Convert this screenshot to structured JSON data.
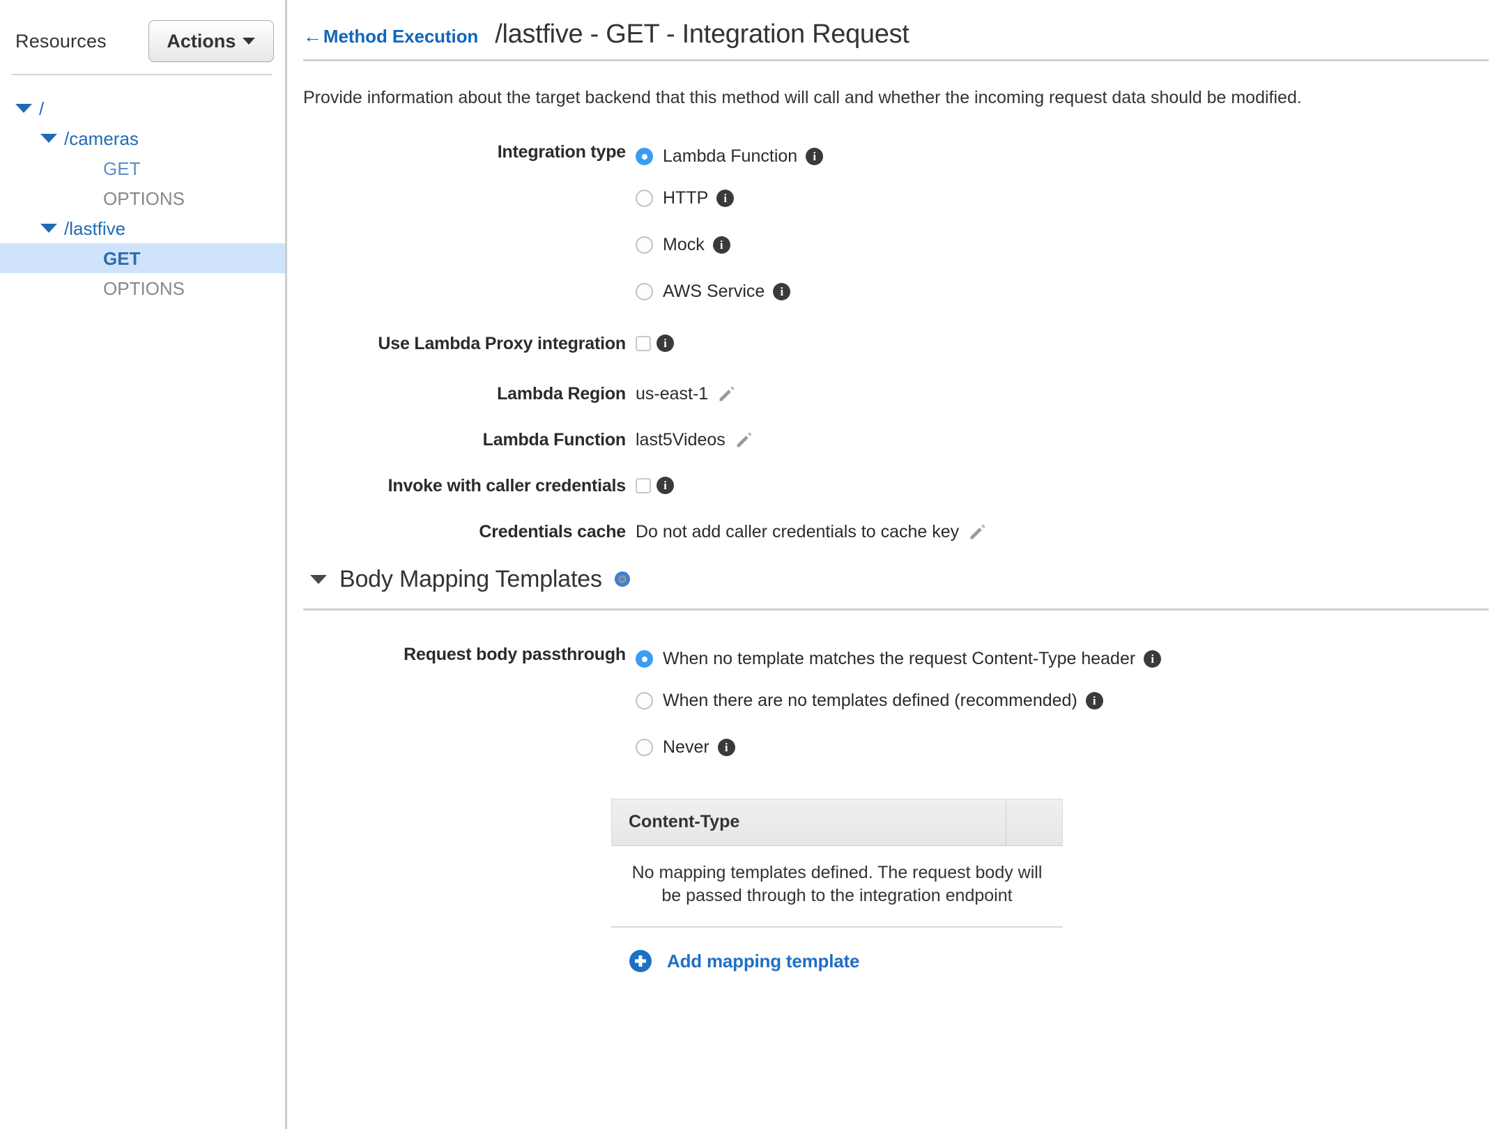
{
  "sidebar": {
    "title": "Resources",
    "actions_button": "Actions",
    "tree": [
      {
        "label": "/",
        "type": "resource",
        "indent": 0,
        "expandable": true,
        "selected": false
      },
      {
        "label": "/cameras",
        "type": "resource",
        "indent": 1,
        "expandable": true,
        "selected": false
      },
      {
        "label": "GET",
        "type": "method-get",
        "indent": 2,
        "expandable": false,
        "selected": false
      },
      {
        "label": "OPTIONS",
        "type": "method-options",
        "indent": 2,
        "expandable": false,
        "selected": false
      },
      {
        "label": "/lastfive",
        "type": "resource",
        "indent": 1,
        "expandable": true,
        "selected": false
      },
      {
        "label": "GET",
        "type": "method-get-selected",
        "indent": 2,
        "expandable": false,
        "selected": true
      },
      {
        "label": "OPTIONS",
        "type": "method-options",
        "indent": 2,
        "expandable": false,
        "selected": false
      }
    ]
  },
  "header": {
    "back_link": "Method Execution",
    "back_arrow": "←",
    "title": "/lastfive - GET - Integration Request"
  },
  "intro": "Provide information about the target backend that this method will call and whether the incoming request data should be modified.",
  "form": {
    "integration_type": {
      "label": "Integration type",
      "options": [
        {
          "label": "Lambda Function",
          "selected": true,
          "has_info": true
        },
        {
          "label": "HTTP",
          "selected": false,
          "has_info": true
        },
        {
          "label": "Mock",
          "selected": false,
          "has_info": true
        },
        {
          "label": "AWS Service",
          "selected": false,
          "has_info": true
        }
      ]
    },
    "lambda_proxy": {
      "label": "Use Lambda Proxy integration",
      "checked": false,
      "has_info": true
    },
    "lambda_region": {
      "label": "Lambda Region",
      "value": "us-east-1",
      "editable": true
    },
    "lambda_function": {
      "label": "Lambda Function",
      "value": "last5Videos",
      "editable": true
    },
    "caller_credentials": {
      "label": "Invoke with caller credentials",
      "checked": false,
      "has_info": true
    },
    "credentials_cache": {
      "label": "Credentials cache",
      "value": "Do not add caller credentials to cache key",
      "editable": true
    }
  },
  "body_mapping": {
    "section_title": "Body Mapping Templates",
    "passthrough": {
      "label": "Request body passthrough",
      "options": [
        {
          "label": "When no template matches the request Content-Type header",
          "selected": true,
          "has_info": true
        },
        {
          "label": "When there are no templates defined (recommended)",
          "selected": false,
          "has_info": true
        },
        {
          "label": "Never",
          "selected": false,
          "has_info": true
        }
      ]
    },
    "table": {
      "column_header": "Content-Type",
      "empty_message": "No mapping templates defined. The request body will be passed through to the integration endpoint"
    },
    "add_link": "Add mapping template"
  },
  "colors": {
    "link_blue": "#1f6bb5",
    "accent_blue": "#3b9cf4",
    "selected_row": "#cfe3fb",
    "text": "#333333",
    "muted": "#888888"
  }
}
